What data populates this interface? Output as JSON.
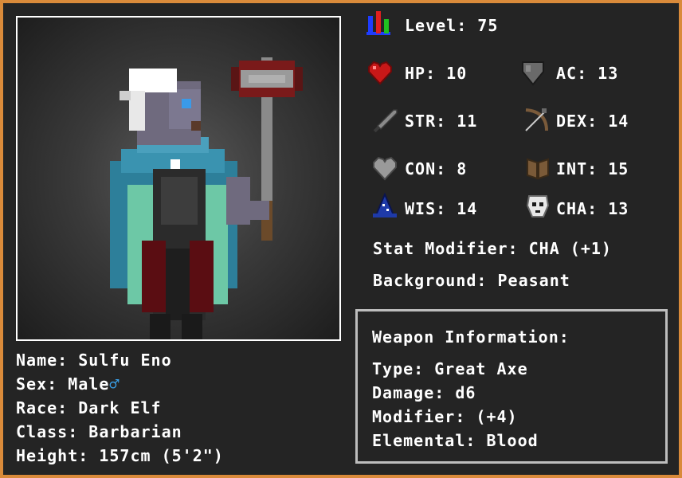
{
  "level": {
    "label": "Level:",
    "value": "75"
  },
  "stats": {
    "hp": {
      "label": "HP:",
      "value": "10"
    },
    "ac": {
      "label": "AC:",
      "value": "13"
    },
    "str": {
      "label": "STR:",
      "value": "11"
    },
    "dex": {
      "label": "DEX:",
      "value": "14"
    },
    "con": {
      "label": "CON:",
      "value": "8"
    },
    "int": {
      "label": "INT:",
      "value": "15"
    },
    "wis": {
      "label": "WIS:",
      "value": "14"
    },
    "cha": {
      "label": "CHA:",
      "value": "13"
    }
  },
  "stat_modifier": {
    "label": "Stat Modifier:",
    "value": "CHA (+1)"
  },
  "background": {
    "label": "Background:",
    "value": "Peasant"
  },
  "weapon": {
    "title": "Weapon Information:",
    "type": {
      "label": "Type:",
      "value": "Great Axe"
    },
    "damage": {
      "label": "Damage:",
      "value": "d6"
    },
    "modifier": {
      "label": "Modifier:",
      "value": "(+4)"
    },
    "elemental": {
      "label": "Elemental:",
      "value": "Blood"
    }
  },
  "character": {
    "name": {
      "label": "Name:",
      "value": "Sulfu Eno"
    },
    "sex": {
      "label": "Sex:",
      "value": "Male",
      "symbol": "♂"
    },
    "race": {
      "label": "Race:",
      "value": "Dark Elf"
    },
    "class": {
      "label": "Class:",
      "value": "Barbarian"
    },
    "height": {
      "label": "Height:",
      "value": "157cm (5'2\")"
    }
  },
  "colors": {
    "frame": "#d98a3a",
    "background": "#242424",
    "text": "#ffffff",
    "sex_symbol": "#3aa0e8"
  },
  "icons": [
    "level-bars-icon",
    "heart-icon",
    "shield-icon",
    "sword-icon",
    "bow-icon",
    "grey-heart-icon",
    "book-icon",
    "wizard-hat-icon",
    "skull-mask-icon"
  ]
}
